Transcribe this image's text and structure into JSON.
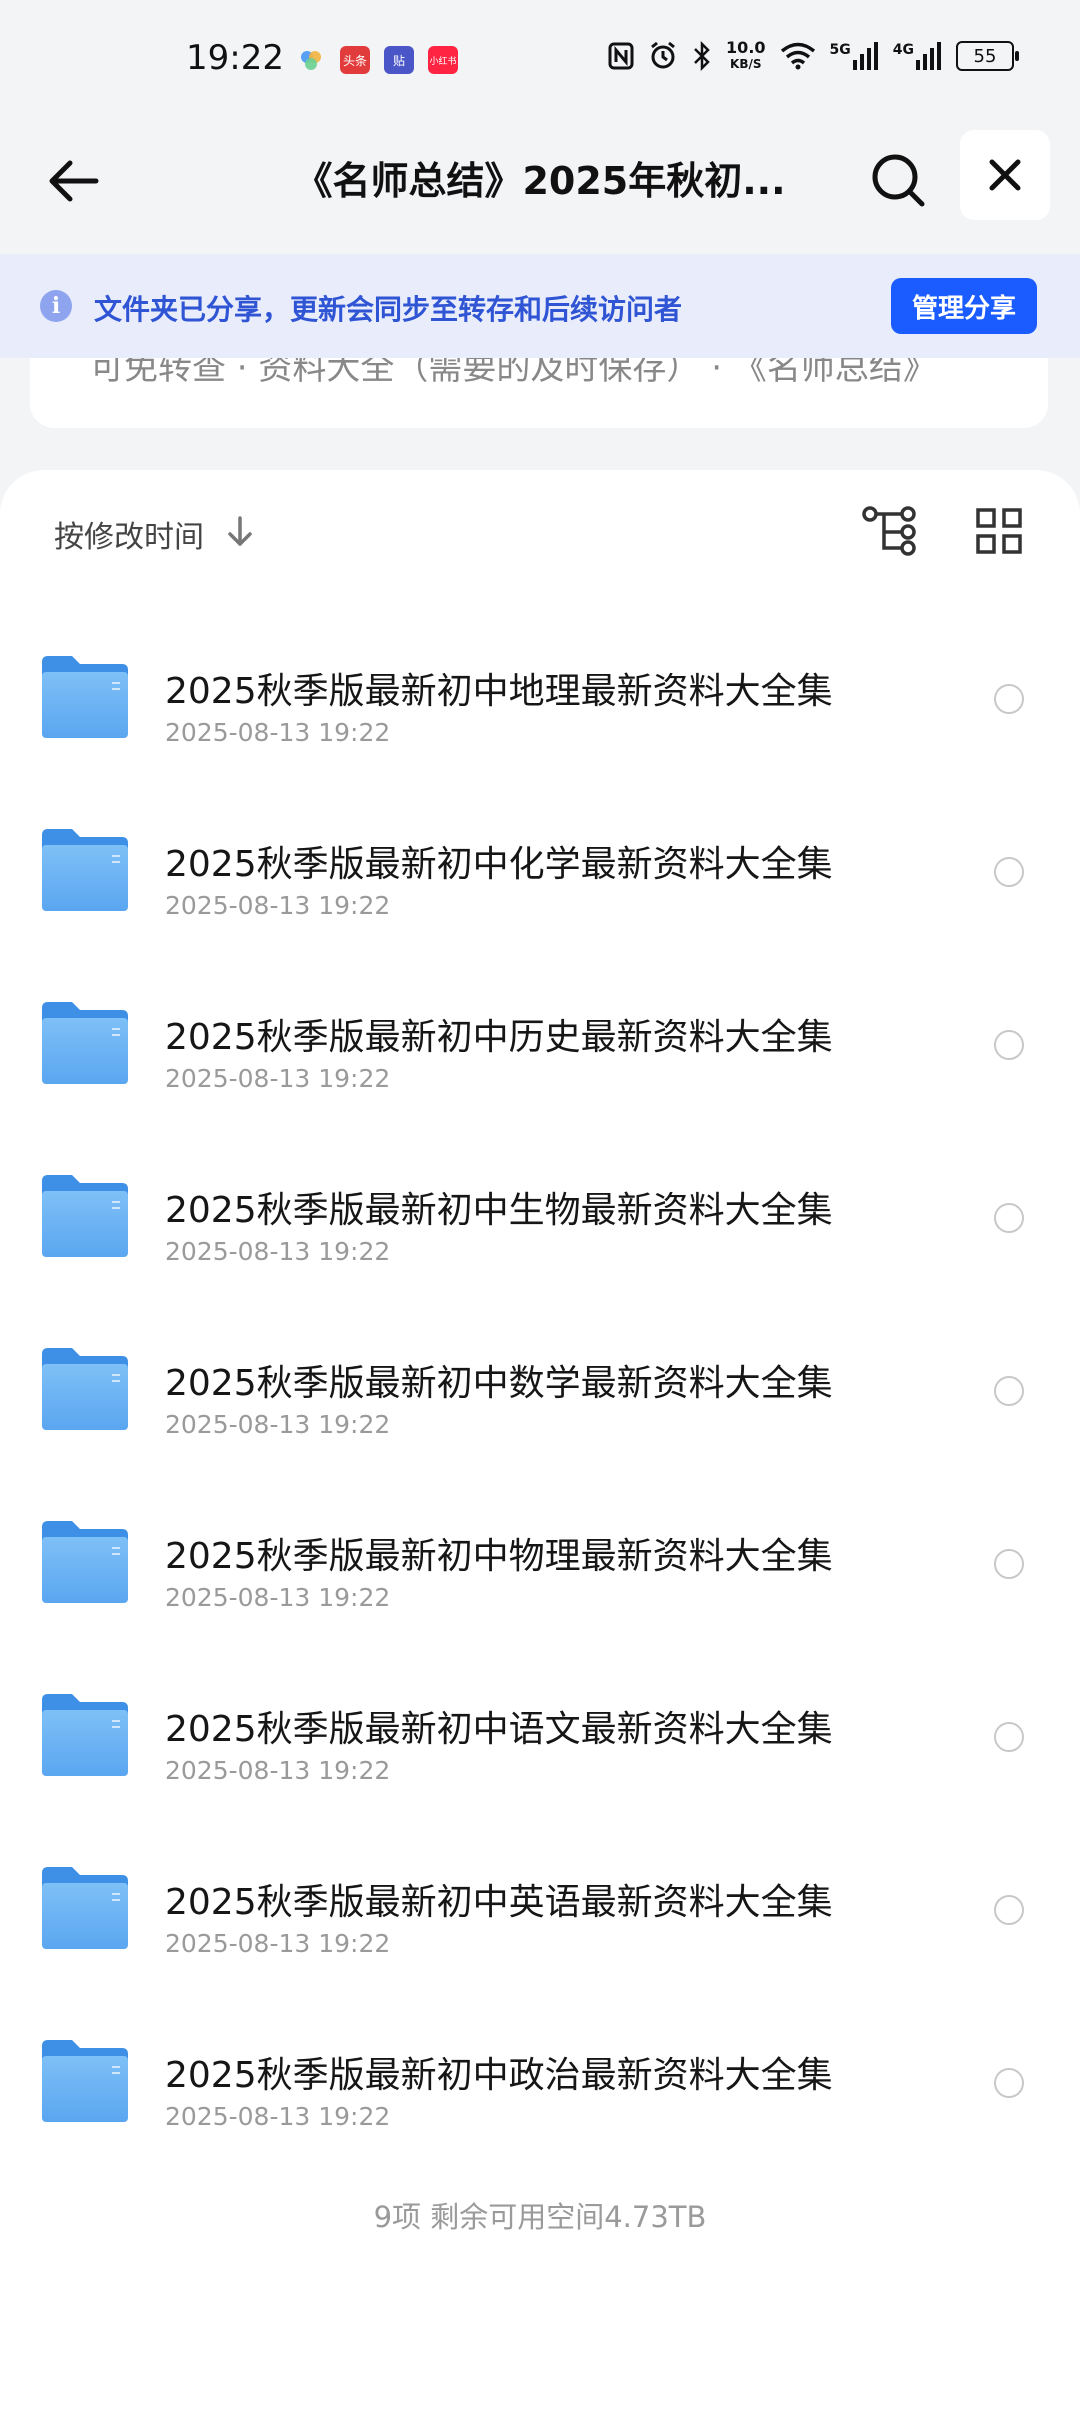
{
  "status_bar": {
    "time": "19:22",
    "apps": [
      {
        "label": "",
        "color": "#ffffff"
      },
      {
        "label": "头条",
        "color": "#e23b3b"
      },
      {
        "label": "贴",
        "color": "#4a56c8"
      },
      {
        "label": "小红书",
        "color": "#ff2442"
      }
    ],
    "net_speed_value": "10.0",
    "net_speed_unit": "KB/S",
    "net1": "5G",
    "net2": "4G",
    "battery": "55"
  },
  "header": {
    "title": "《名师总结》2025年秋初..."
  },
  "banner": {
    "text": "文件夹已分享，更新会同步至转存和后续访问者",
    "manage_label": "管理分享"
  },
  "hidden_card_text": "可免转查 · 资料大全（需要的及时保存） · 《名师总结》",
  "sort": {
    "label": "按修改时间"
  },
  "files": [
    {
      "name": "2025秋季版最新初中地理最新资料大全集",
      "date": "2025-08-13 19:22"
    },
    {
      "name": "2025秋季版最新初中化学最新资料大全集",
      "date": "2025-08-13 19:22"
    },
    {
      "name": "2025秋季版最新初中历史最新资料大全集",
      "date": "2025-08-13 19:22"
    },
    {
      "name": "2025秋季版最新初中生物最新资料大全集",
      "date": "2025-08-13 19:22"
    },
    {
      "name": "2025秋季版最新初中数学最新资料大全集",
      "date": "2025-08-13 19:22"
    },
    {
      "name": "2025秋季版最新初中物理最新资料大全集",
      "date": "2025-08-13 19:22"
    },
    {
      "name": "2025秋季版最新初中语文最新资料大全集",
      "date": "2025-08-13 19:22"
    },
    {
      "name": "2025秋季版最新初中英语最新资料大全集",
      "date": "2025-08-13 19:22"
    },
    {
      "name": "2025秋季版最新初中政治最新资料大全集",
      "date": "2025-08-13 19:22"
    }
  ],
  "footer": "9项 剩余可用空间4.73TB",
  "colors": {
    "accent": "#1a5cff",
    "banner_bg": "#e8ecfb",
    "folder": "#5aa6f0"
  }
}
